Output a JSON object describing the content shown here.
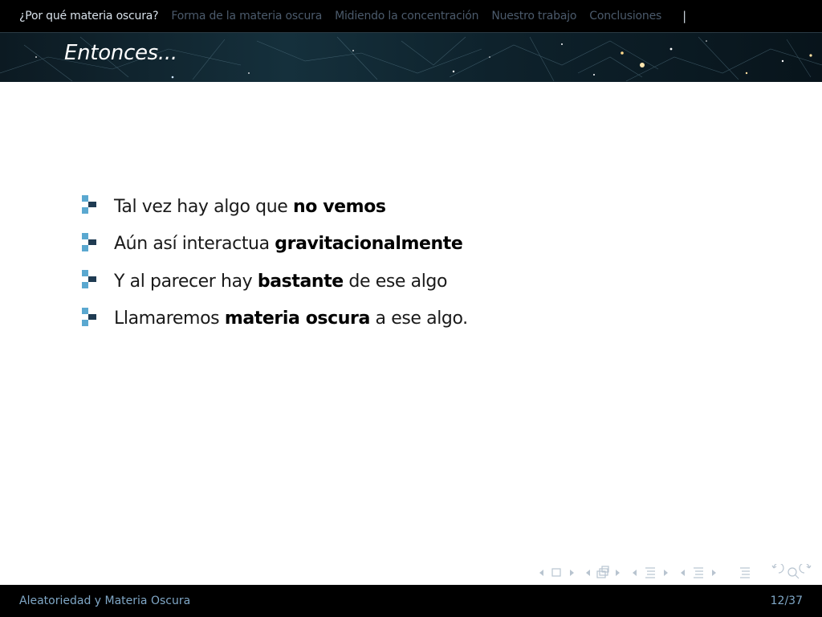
{
  "nav": {
    "sections": [
      {
        "label": "¿Por qué materia oscura?",
        "active": true
      },
      {
        "label": "Forma de la materia oscura",
        "active": false
      },
      {
        "label": "Midiendo la concentración",
        "active": false
      },
      {
        "label": "Nuestro trabajo",
        "active": false
      },
      {
        "label": "Conclusiones",
        "active": false
      }
    ],
    "separator": "|"
  },
  "frame": {
    "title": "Entonces..."
  },
  "bullets": [
    {
      "before": "Tal vez hay algo que ",
      "bold": "no vemos",
      "after": ""
    },
    {
      "before": "Aún así interactua ",
      "bold": "gravitacionalmente",
      "after": ""
    },
    {
      "before": "Y al parecer hay ",
      "bold": "bastante",
      "after": " de ese algo"
    },
    {
      "before": "Llamaremos ",
      "bold": "materia oscura",
      "after": " a ese algo."
    }
  ],
  "footer": {
    "title": "Aleatoriedad y Materia Oscura",
    "page": "12/37"
  },
  "colors": {
    "bullet_light": "#5aa8d0",
    "bullet_dark": "#1f3b52",
    "nav_symbol": "#b8c4d0"
  },
  "icons": {
    "bullet": "square-bullet-icon",
    "nav_symbols": [
      "prev-slide-icon",
      "slide-icon",
      "next-slide-icon",
      "prev-frame-icon",
      "frame-icon",
      "next-frame-icon",
      "prev-subsection-icon",
      "subsection-icon",
      "next-subsection-icon",
      "prev-section-icon",
      "section-icon",
      "next-section-icon",
      "appendix-icon",
      "back-icon",
      "search-icon",
      "forward-icon"
    ]
  }
}
